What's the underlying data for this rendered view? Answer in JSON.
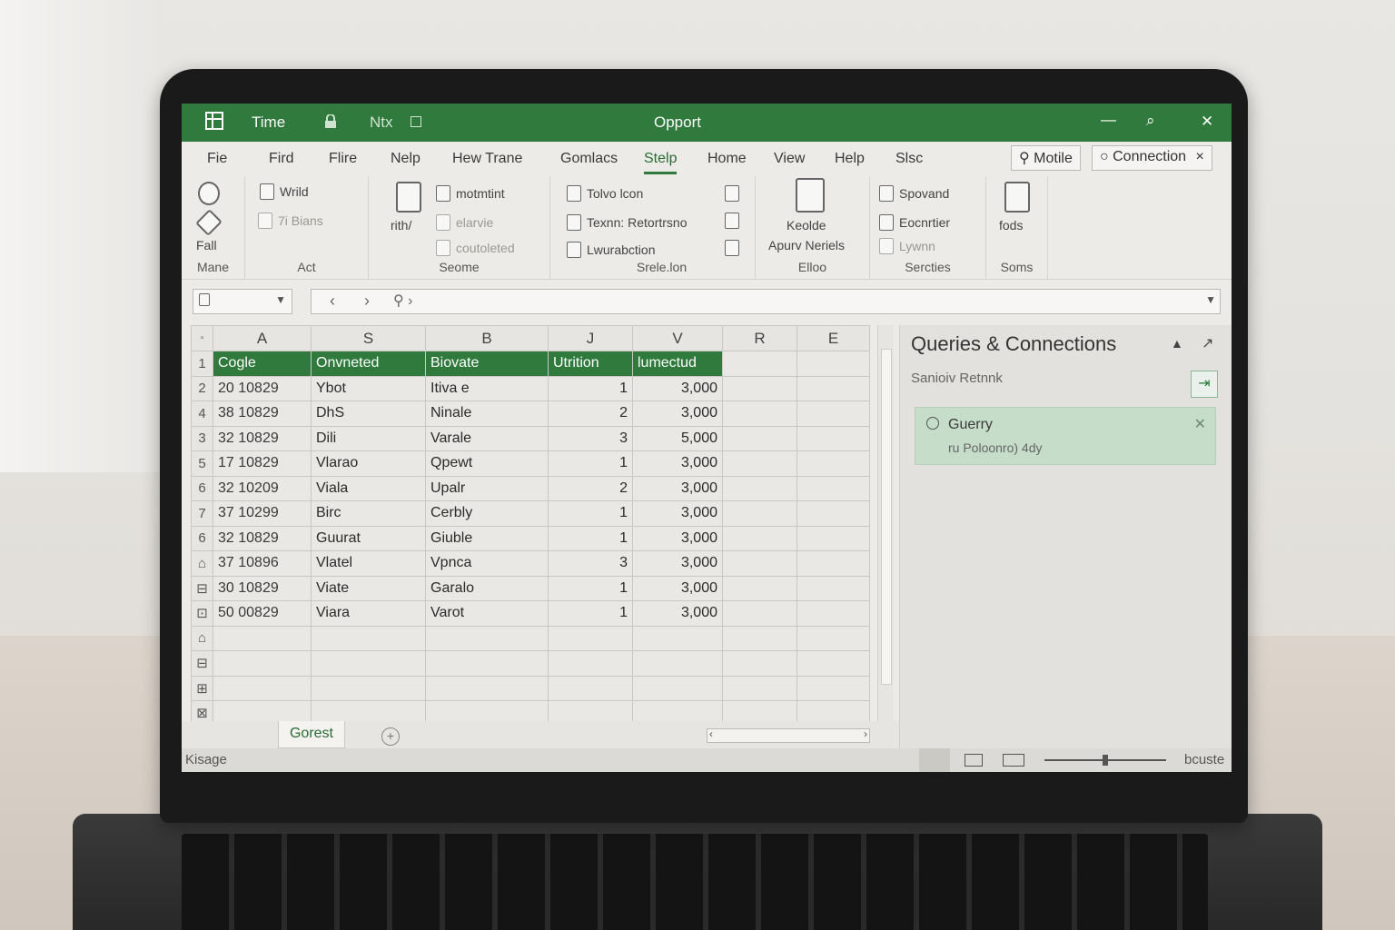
{
  "window": {
    "app_icon": "grid-icon",
    "tab1": "Time",
    "tab2": "Ntx",
    "title": "Opport",
    "minimize": "—",
    "restore": "⌕",
    "close": "✕"
  },
  "menu": {
    "tabs": [
      "Fie",
      "Fird",
      "Flire",
      "Nelp",
      "Hew Trane",
      "Gomlacs",
      "Stelp",
      "Home",
      "View",
      "Help",
      "Slsc"
    ],
    "active_index": 6,
    "search_button": "Motile",
    "connection_button": "Connection",
    "connection_close": "×"
  },
  "ribbon": {
    "group1": {
      "big": "Fall",
      "label": "Mane"
    },
    "group2": {
      "items": [
        "Wrild",
        "7i Bians"
      ],
      "label": "Act"
    },
    "group3": {
      "big": "rith/",
      "items": [
        "motmtint",
        "elarvie",
        "coutoleted"
      ],
      "label": "Seome"
    },
    "group4": {
      "items": [
        "Tolvo lcon",
        "Texnn: Retortrsno",
        "Lwurabction"
      ],
      "label": "Srele.lon"
    },
    "group5": {
      "big": "Keolde",
      "big2": "Apurv Neriels",
      "label": "Elloo"
    },
    "group6": {
      "items": [
        "Spovand",
        "Eocnrtier",
        "Lywnn"
      ],
      "label": "Sercties"
    },
    "group7": {
      "big": "fods",
      "label": "Soms"
    }
  },
  "formula_bar": {
    "name_box_icon": "cell-icon",
    "nav_back": "‹",
    "nav_forward": "›",
    "fx": "⚲ ›"
  },
  "sheet": {
    "columns": [
      "A",
      "S",
      "B",
      "J",
      "V",
      "R",
      "E"
    ],
    "header_row": [
      "Cogle",
      "Onvneted",
      "Biovate",
      "Utrition",
      "lumectud"
    ],
    "row_numbers": [
      "1",
      "2",
      "4",
      "3",
      "5",
      "6",
      "7",
      "6",
      "⌂",
      "⊟",
      "⊡",
      "⌂",
      "⊟",
      "⊞",
      "⊠"
    ],
    "rows": [
      [
        "20 10829",
        "Ybot",
        "Itiva e",
        "1",
        "3,000"
      ],
      [
        "38 10829",
        "DhS",
        "Ninale",
        "2",
        "3,000"
      ],
      [
        "32 10829",
        "Dili",
        "Varale",
        "3",
        "5,000"
      ],
      [
        "17 10829",
        "Vlarao",
        "Qpewt",
        "1",
        "3,000"
      ],
      [
        "32 10209",
        "Viala",
        "Upalr",
        "2",
        "3,000"
      ],
      [
        "37 10299",
        "Birc",
        "Cerbly",
        "1",
        "3,000"
      ],
      [
        "32 10829",
        "Guurat",
        "Giuble",
        "1",
        "3,000"
      ],
      [
        "37 10896",
        "Vlatel",
        "Vpnca",
        "3",
        "3,000"
      ],
      [
        "30 10829",
        "Viate",
        "Garalo",
        "1",
        "3,000"
      ],
      [
        "50 00829",
        "Viara",
        "Varot",
        "1",
        "3,000"
      ]
    ]
  },
  "sheet_tab": "Gorest",
  "add_sheet": "+",
  "status": {
    "left": "Kisage",
    "right": "bcuste"
  },
  "queries": {
    "title": "Queries & Connections",
    "subtitle": "Sanioiv Retnnk",
    "query_name": "Guerry",
    "query_desc": "ru Poloonro) 4dy",
    "close": "✕",
    "refresh_icon": "refresh-icon"
  },
  "colors": {
    "accent": "#2f7a3c",
    "query_card": "#c5ddc9"
  }
}
